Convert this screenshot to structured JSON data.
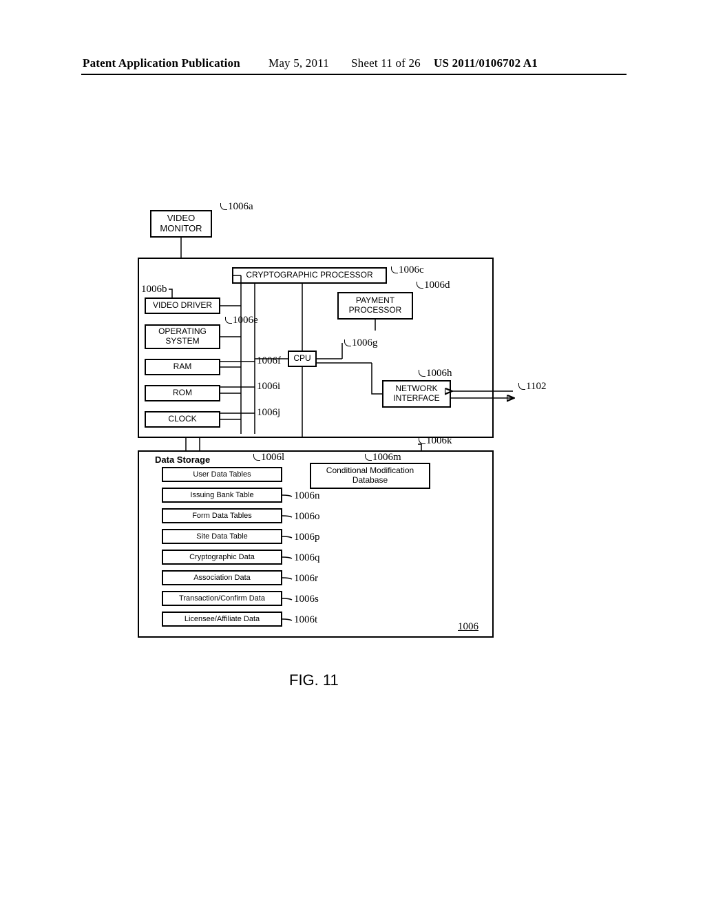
{
  "header": {
    "left": "Patent Application Publication",
    "middle_date": "May 5, 2011",
    "middle_sheet": "Sheet 11 of 26",
    "right": "US 2011/0106702 A1"
  },
  "labels": {
    "video_monitor": "VIDEO\nMONITOR",
    "video_driver": "VIDEO DRIVER",
    "operating_system": "OPERATING\nSYSTEM",
    "ram": "RAM",
    "rom": "ROM",
    "clock": "CLOCK",
    "crypto_proc": "CRYPTOGRAPHIC PROCESSOR",
    "payment_proc": "PAYMENT\nPROCESSOR",
    "cpu": "CPU",
    "network_iface": "NETWORK\nINTERFACE",
    "data_storage": "Data Storage",
    "cond_db": "Conditional Modification\nDatabase",
    "tables": {
      "user": "User Data Tables",
      "bank": "Issuing Bank Table",
      "form": "Form Data Tables",
      "site": "Site Data Table",
      "crypto": "Cryptographic Data",
      "assoc": "Association Data",
      "txn": "Transaction/Confirm Data",
      "lic": "Licensee/Affiliate Data"
    }
  },
  "refs": {
    "a": "1006a",
    "b": "1006b",
    "c": "1006c",
    "d": "1006d",
    "e": "1006e",
    "f": "1006f",
    "g": "1006g",
    "h": "1006h",
    "i": "1006i",
    "j": "1006j",
    "k": "1006k",
    "l": "1006l",
    "m": "1006m",
    "n": "1006n",
    "o": "1006o",
    "p": "1006p",
    "q": "1006q",
    "r": "1006r",
    "s": "1006s",
    "t": "1006t",
    "main": "1006",
    "ext": "1102"
  },
  "figure": "FIG. 11"
}
